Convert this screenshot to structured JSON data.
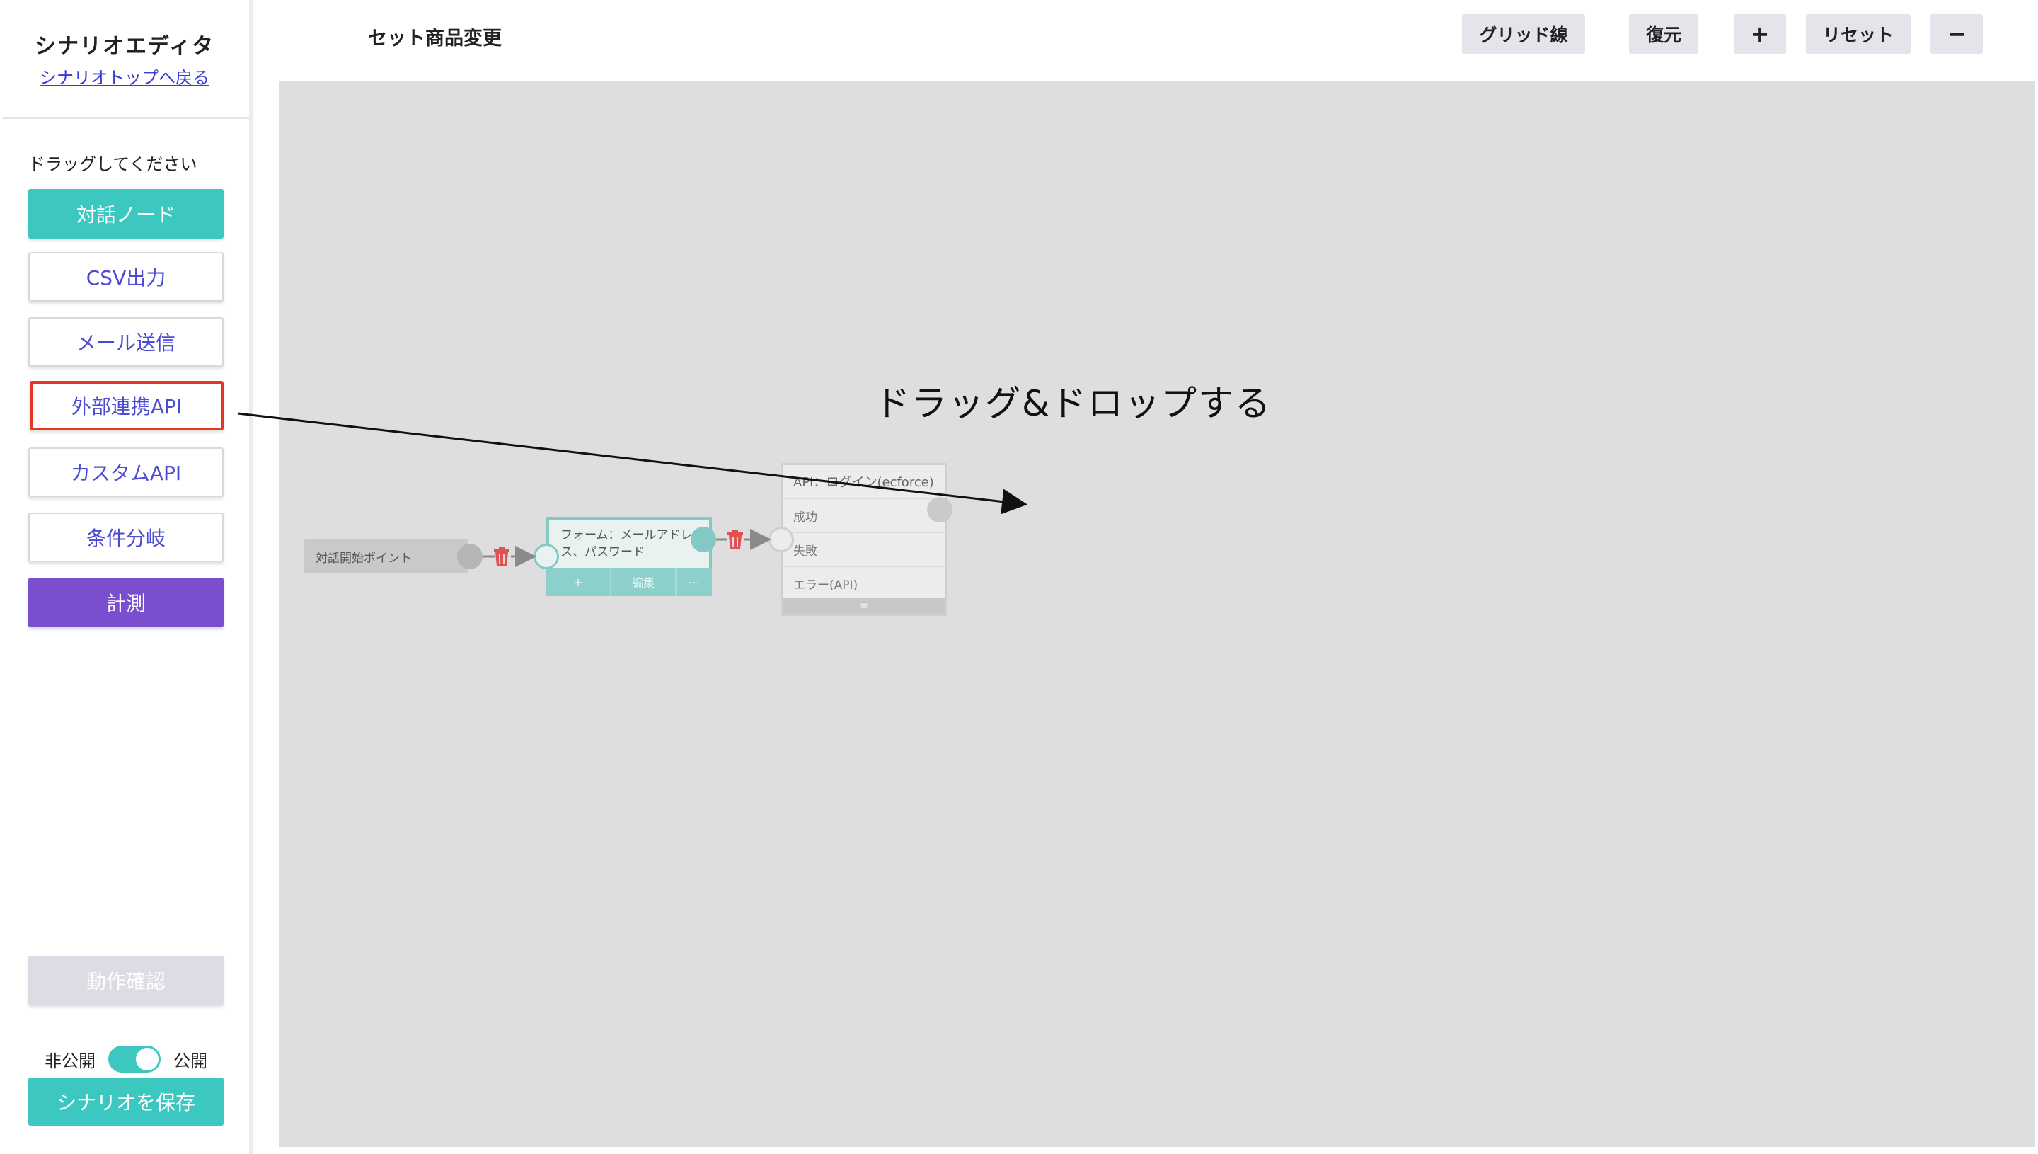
{
  "sidebar": {
    "title": "シナリオエディタ",
    "back_link": "シナリオトップへ戻る",
    "drag_hint": "ドラッグしてください",
    "node_buttons": [
      {
        "label": "対話ノード"
      },
      {
        "label": "CSV出力"
      },
      {
        "label": "メール送信"
      },
      {
        "label": "外部連携API"
      },
      {
        "label": "カスタムAPI"
      },
      {
        "label": "条件分岐"
      },
      {
        "label": "計測"
      }
    ],
    "check_button": "動作確認",
    "toggle": {
      "off_label": "非公開",
      "on_label": "公開",
      "state": "公開"
    },
    "save_button": "シナリオを保存"
  },
  "header": {
    "scenario_name": "セット商品変更",
    "buttons": {
      "grid": "グリッド線",
      "restore": "復元",
      "zoom_in": "+",
      "reset": "リセット",
      "zoom_out": "−"
    }
  },
  "canvas": {
    "instruction": "ドラッグ&ドロップする",
    "start_node": "対話開始ポイント",
    "form_node": {
      "text": "フォーム：メールアドレス、パスワード",
      "footer": [
        "+",
        "編集",
        "⋯"
      ]
    },
    "api_node": {
      "title": "API：ログイン(ecforce)",
      "rows": [
        "成功",
        "失敗",
        "エラー(API)"
      ],
      "footer": "≡"
    }
  },
  "colors": {
    "teal": "#3cc8c0",
    "purple": "#7a4fcf",
    "highlight_red": "#e03b22",
    "link_blue": "#3a3ad6",
    "canvas_bg": "#dedede"
  }
}
